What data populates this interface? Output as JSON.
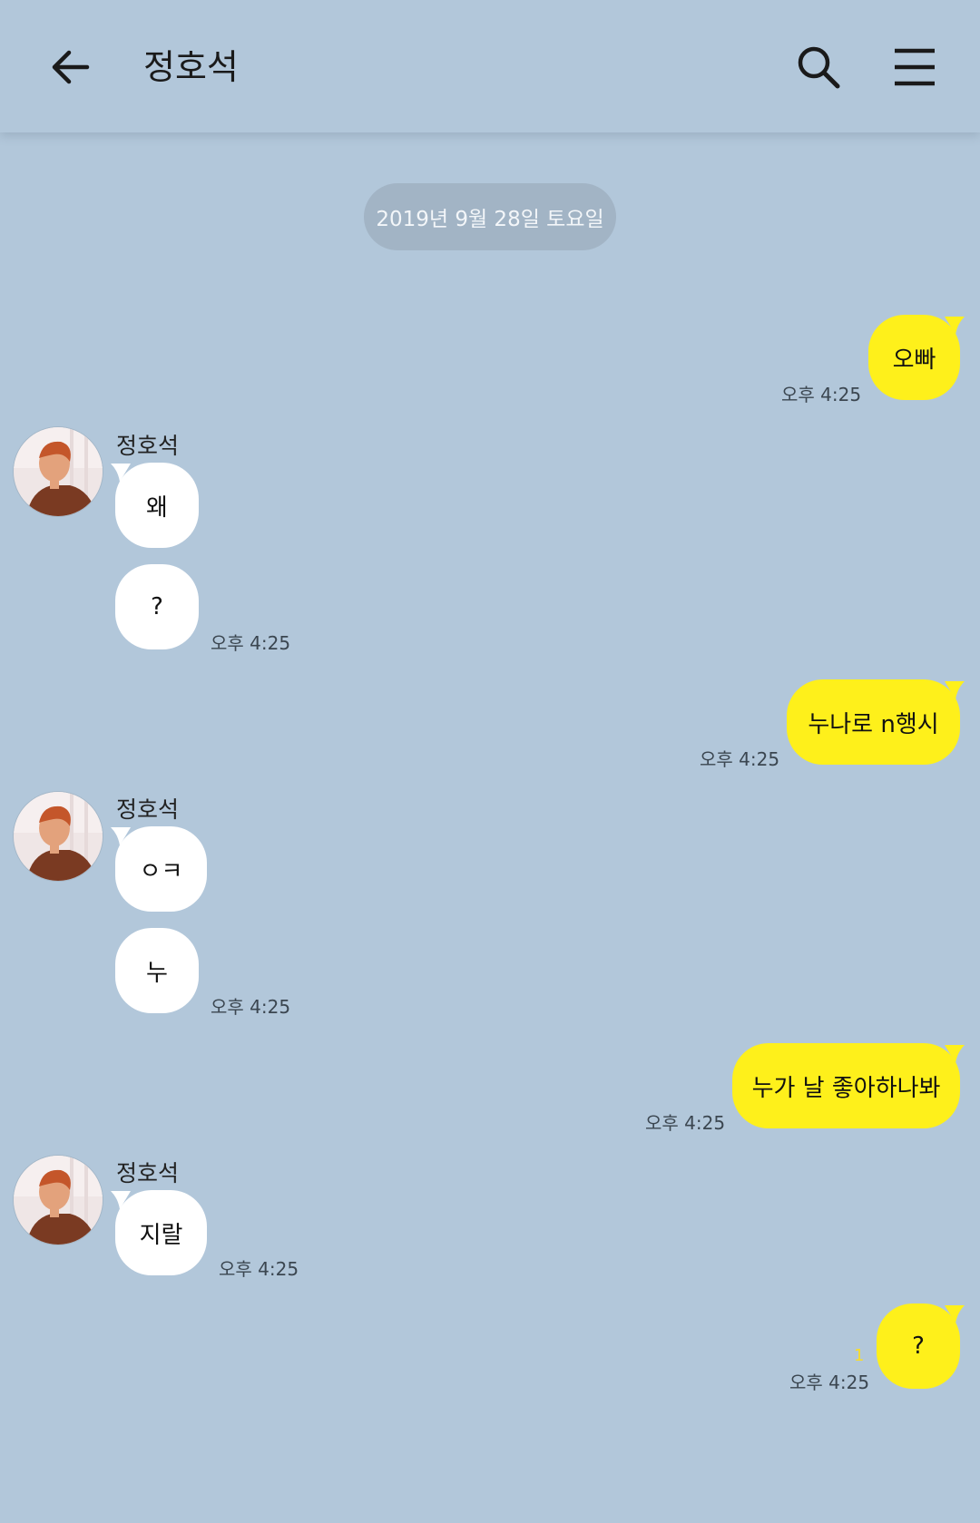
{
  "header": {
    "title": "정호석",
    "back_icon": "arrow-left-icon",
    "search_icon": "search-icon",
    "menu_icon": "hamburger-menu-icon"
  },
  "date_divider": "2019년 9월 28일 토요일",
  "colors": {
    "background": "#b2c7da",
    "my_bubble": "#fef01b",
    "their_bubble": "#ffffff",
    "unread_count": "#fadd26"
  },
  "messages": [
    {
      "from": "me",
      "text": "오빠",
      "time": "오후 4:25"
    },
    {
      "from": "them",
      "sender": "정호석",
      "texts": [
        "왜",
        "?"
      ],
      "time": "오후 4:25"
    },
    {
      "from": "me",
      "text": "누나로 n행시",
      "time": "오후 4:25"
    },
    {
      "from": "them",
      "sender": "정호석",
      "texts": [
        "ㅇㅋ",
        "누"
      ],
      "time": "오후 4:25"
    },
    {
      "from": "me",
      "text": "누가 날 좋아하나봐",
      "time": "오후 4:25"
    },
    {
      "from": "them",
      "sender": "정호석",
      "texts": [
        "지랄"
      ],
      "time": "오후 4:25"
    },
    {
      "from": "me",
      "text": "?",
      "time": "오후 4:25",
      "unread": "1"
    }
  ]
}
